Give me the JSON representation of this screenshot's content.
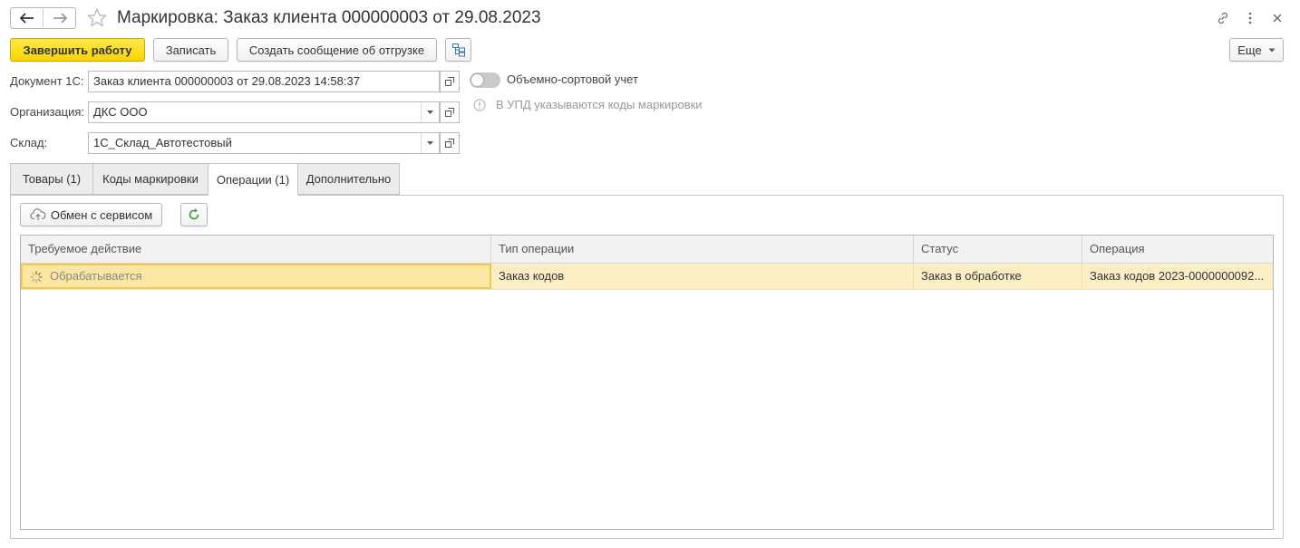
{
  "window": {
    "title": "Маркировка: Заказ клиента 000000003 от 29.08.2023"
  },
  "toolbar": {
    "finish_label": "Завершить работу",
    "save_label": "Записать",
    "shipment_label": "Создать сообщение об отгрузке",
    "more_label": "Еще"
  },
  "form": {
    "document_label": "Документ 1С:",
    "document_value": "Заказ клиента 000000003 от 29.08.2023 14:58:37",
    "organization_label": "Организация:",
    "organization_value": "ДКС ООО",
    "warehouse_label": "Склад:",
    "warehouse_value": "1С_Склад_Автотестовый",
    "bulk_toggle_label": "Объемно-сортовой учет",
    "bulk_toggle_on": false,
    "upd_note": "В УПД указываются коды маркировки"
  },
  "tabs": [
    {
      "label": "Товары (1)",
      "active": false
    },
    {
      "label": "Коды маркировки",
      "active": false
    },
    {
      "label": "Операции (1)",
      "active": true
    },
    {
      "label": "Дополнительно",
      "active": false
    }
  ],
  "operations": {
    "exchange_label": "Обмен с сервисом",
    "columns": [
      "Требуемое действие",
      "Тип операции",
      "Статус",
      "Операция"
    ],
    "rows": [
      {
        "action": "Обрабатывается",
        "type": "Заказ кодов",
        "status": "Заказ в обработке",
        "operation": "Заказ кодов 2023-0000000092..."
      }
    ]
  },
  "icons": {
    "back": "arrow-left-icon",
    "forward": "arrow-right-icon",
    "favorite": "star-icon",
    "link": "link-icon",
    "menu": "kebab-menu-icon",
    "close": "close-icon",
    "structure": "document-structure-icon",
    "open": "open-form-icon",
    "dropdown": "chevron-down-icon",
    "info": "info-icon",
    "cloud": "cloud-upload-icon",
    "refresh": "refresh-icon",
    "spinner": "loading-spinner-icon"
  },
  "colors": {
    "primary_button": "#f6d500",
    "selected_row": "#fcefc6",
    "refresh_green": "#3aa335"
  }
}
